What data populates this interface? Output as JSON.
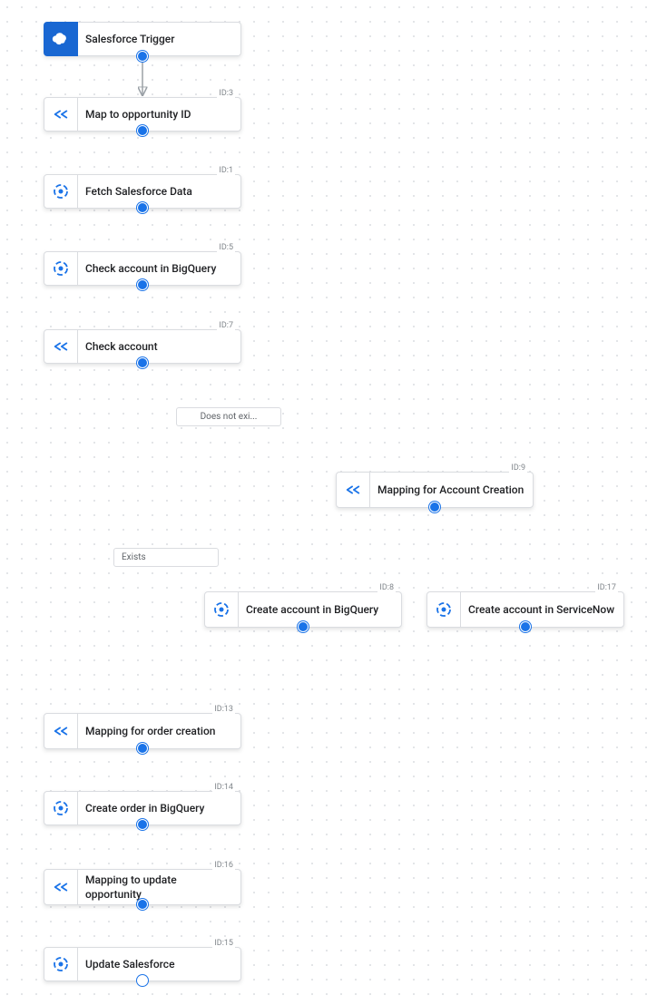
{
  "nodes": {
    "trigger": {
      "label": "Salesforce Trigger"
    },
    "n3": {
      "label": "Map to opportunity ID",
      "id": "ID:3"
    },
    "n1": {
      "label": "Fetch Salesforce Data",
      "id": "ID:1"
    },
    "n5": {
      "label": "Check account in BigQuery",
      "id": "ID:5"
    },
    "n7": {
      "label": "Check account",
      "id": "ID:7"
    },
    "n9": {
      "label": "Mapping for Account Creation",
      "id": "ID:9"
    },
    "n8": {
      "label": "Create account in BigQuery",
      "id": "ID:8"
    },
    "n17": {
      "label": "Create account in ServiceNow",
      "id": "ID:17"
    },
    "n13": {
      "label": "Mapping for order creation",
      "id": "ID:13"
    },
    "n14": {
      "label": "Create order in BigQuery",
      "id": "ID:14"
    },
    "n16": {
      "label": "Mapping to update opportunity",
      "id": "ID:16"
    },
    "n15": {
      "label": "Update Salesforce",
      "id": "ID:15"
    }
  },
  "edgeLabels": {
    "notexist": "Does not exi...",
    "exists": "Exists"
  }
}
